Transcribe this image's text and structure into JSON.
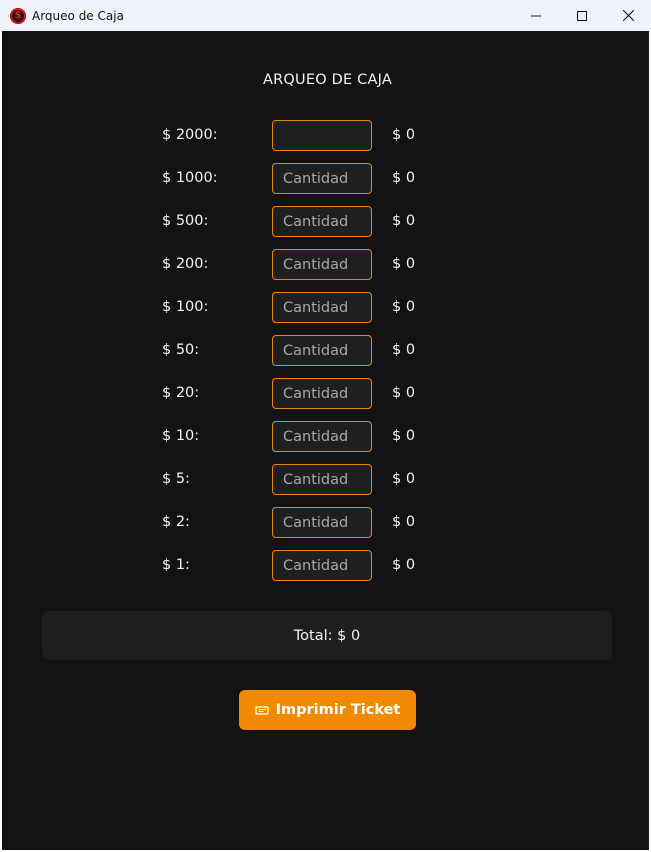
{
  "window": {
    "title": "Arqueo de Caja",
    "icon": "dollar-coin-icon"
  },
  "main": {
    "heading": "ARQUEO DE CAJA",
    "rows": [
      {
        "label": "$ 2000:",
        "value": "",
        "placeholder": "",
        "subtotal": "$ 0"
      },
      {
        "label": "$ 1000:",
        "value": "",
        "placeholder": "Cantidad",
        "subtotal": "$ 0"
      },
      {
        "label": "$ 500:",
        "value": "",
        "placeholder": "Cantidad",
        "subtotal": "$ 0"
      },
      {
        "label": "$ 200:",
        "value": "",
        "placeholder": "Cantidad",
        "subtotal": "$ 0"
      },
      {
        "label": "$ 100:",
        "value": "",
        "placeholder": "Cantidad",
        "subtotal": "$ 0"
      },
      {
        "label": "$ 50:",
        "value": "",
        "placeholder": "Cantidad",
        "subtotal": "$ 0"
      },
      {
        "label": "$ 20:",
        "value": "",
        "placeholder": "Cantidad",
        "subtotal": "$ 0"
      },
      {
        "label": "$ 10:",
        "value": "",
        "placeholder": "Cantidad",
        "subtotal": "$ 0"
      },
      {
        "label": "$ 5:",
        "value": "",
        "placeholder": "Cantidad",
        "subtotal": "$ 0"
      },
      {
        "label": "$ 2:",
        "value": "",
        "placeholder": "Cantidad",
        "subtotal": "$ 0"
      },
      {
        "label": "$ 1:",
        "value": "",
        "placeholder": "Cantidad",
        "subtotal": "$ 0"
      }
    ],
    "total": "Total: $ 0",
    "print_button": {
      "label": "Imprimir Ticket",
      "icon": "ticket-icon"
    }
  },
  "colors": {
    "accent": "#f08a00",
    "background": "#131313",
    "input_border": "#e8861a",
    "panel": "#1e1e1e"
  }
}
